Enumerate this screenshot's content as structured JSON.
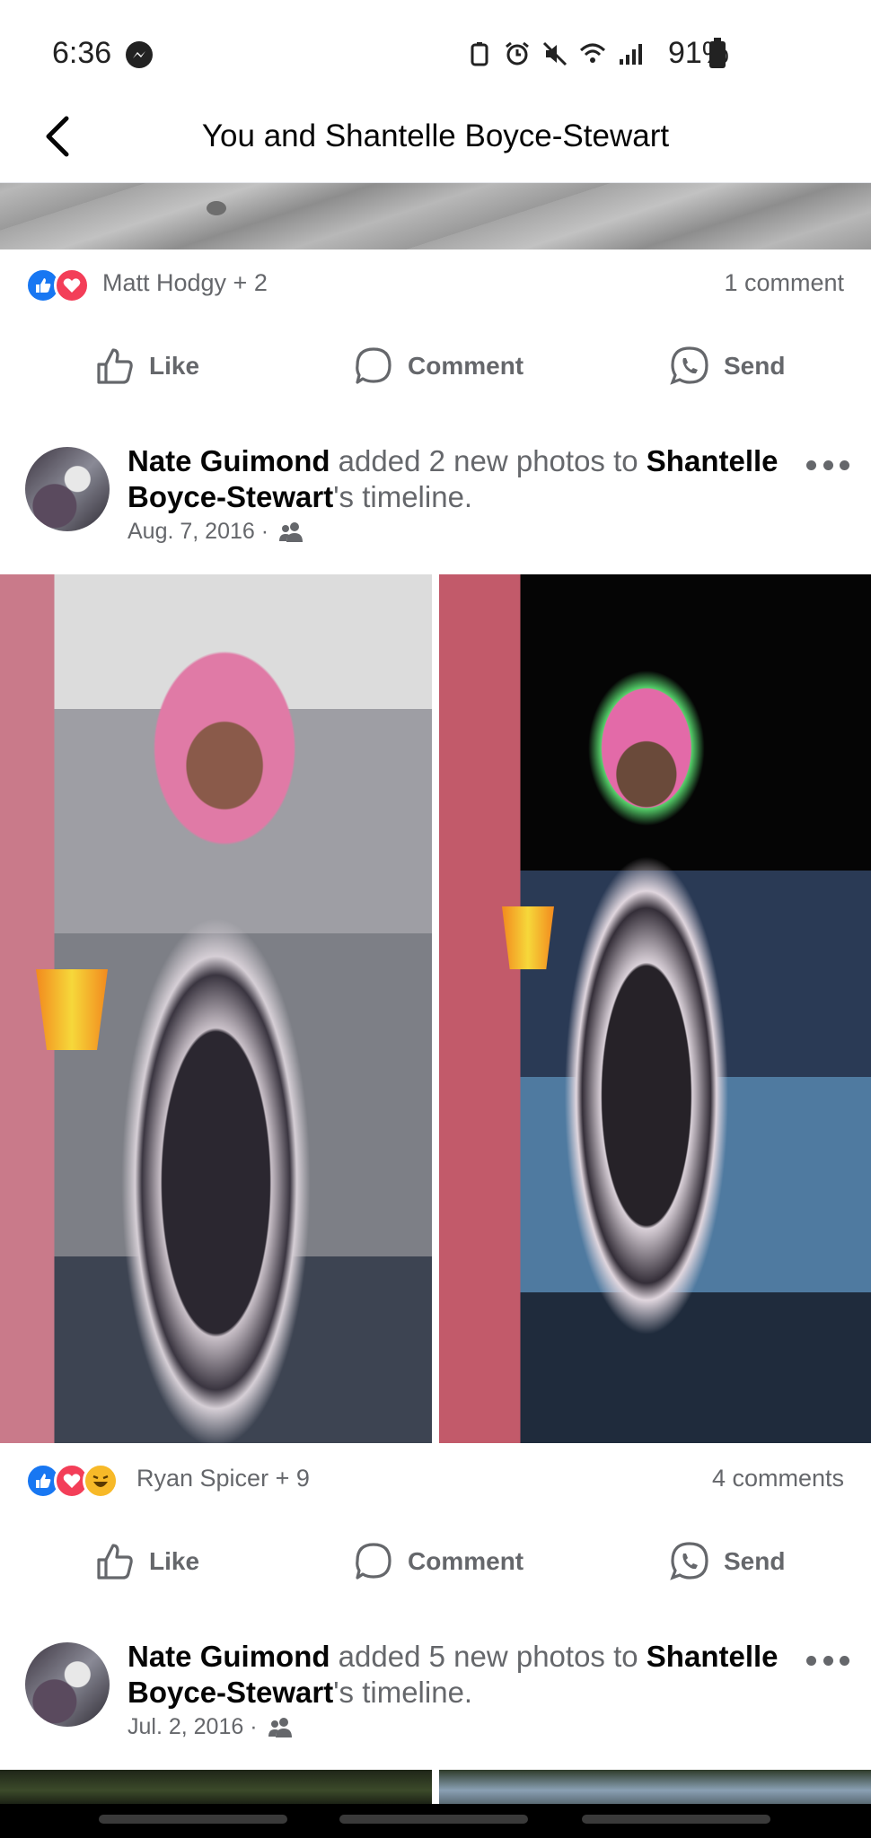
{
  "status_bar": {
    "time": "6:36",
    "battery": "91%",
    "icons": [
      "messenger-icon",
      "nfc-icon",
      "alarm-icon",
      "mute-icon",
      "wifi-icon",
      "signal-icon",
      "battery-icon"
    ]
  },
  "header": {
    "title": "You and Shantelle Boyce-Stewart",
    "back_icon": "back-arrow-icon"
  },
  "posts": [
    {
      "reactions_names": "Matt Hodgy + 2",
      "comments": "1 comment",
      "reactions": [
        "like",
        "love"
      ]
    },
    {
      "author": "Nate Guimond",
      "action": " added 2 new photos to ",
      "target": "Shantelle Boyce-Stewart",
      "suffix": "'s timeline.",
      "date": "Aug. 7, 2016 ·",
      "privacy_icon": "friends-icon",
      "reactions_names": "Ryan Spicer + 9",
      "comments": "4 comments",
      "reactions": [
        "like",
        "love",
        "haha"
      ]
    },
    {
      "author": "Nate Guimond",
      "action": " added 5 new photos to ",
      "target": "Shantelle Boyce-Stewart",
      "suffix": "'s timeline.",
      "date": "Jul. 2, 2016 ·",
      "privacy_icon": "friends-icon"
    }
  ],
  "actions": {
    "like": "Like",
    "comment": "Comment",
    "send": "Send"
  },
  "colors": {
    "facebook_blue": "#1877f2",
    "love_red": "#f33e58",
    "haha_yellow": "#f7b928",
    "secondary_text": "#65676b"
  }
}
